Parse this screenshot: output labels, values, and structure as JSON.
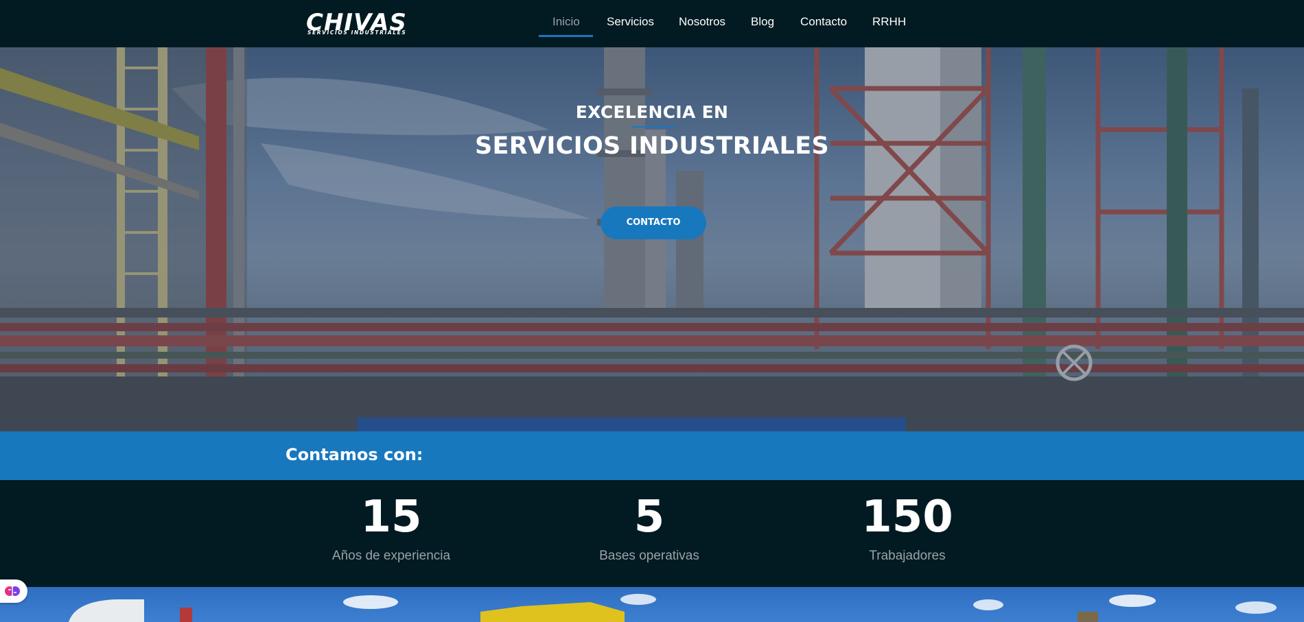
{
  "brand": {
    "logo_text": "CHIVAS",
    "logo_subtext": "SERVICIOS INDUSTRIALES"
  },
  "nav": {
    "items": [
      {
        "label": "Inicio",
        "active": true
      },
      {
        "label": "Servicios",
        "active": false
      },
      {
        "label": "Nosotros",
        "active": false
      },
      {
        "label": "Blog",
        "active": false
      },
      {
        "label": "Contacto",
        "active": false
      },
      {
        "label": "RRHH",
        "active": false
      }
    ]
  },
  "hero": {
    "kicker": "EXCELENCIA EN",
    "title": "SERVICIOS INDUSTRIALES",
    "button_label": "CONTACTO"
  },
  "stats_band": {
    "title": "Contamos con:"
  },
  "stats": [
    {
      "value": "15",
      "label": "Años de experiencia"
    },
    {
      "value": "5",
      "label": "Bases operativas"
    },
    {
      "value": "150",
      "label": "Trabajadores"
    }
  ],
  "floating_widget": {
    "icon": "brain-icon"
  },
  "colors": {
    "accent": "#1878be",
    "header_bg": "#021a22",
    "muted_text": "#9aa3a8"
  }
}
